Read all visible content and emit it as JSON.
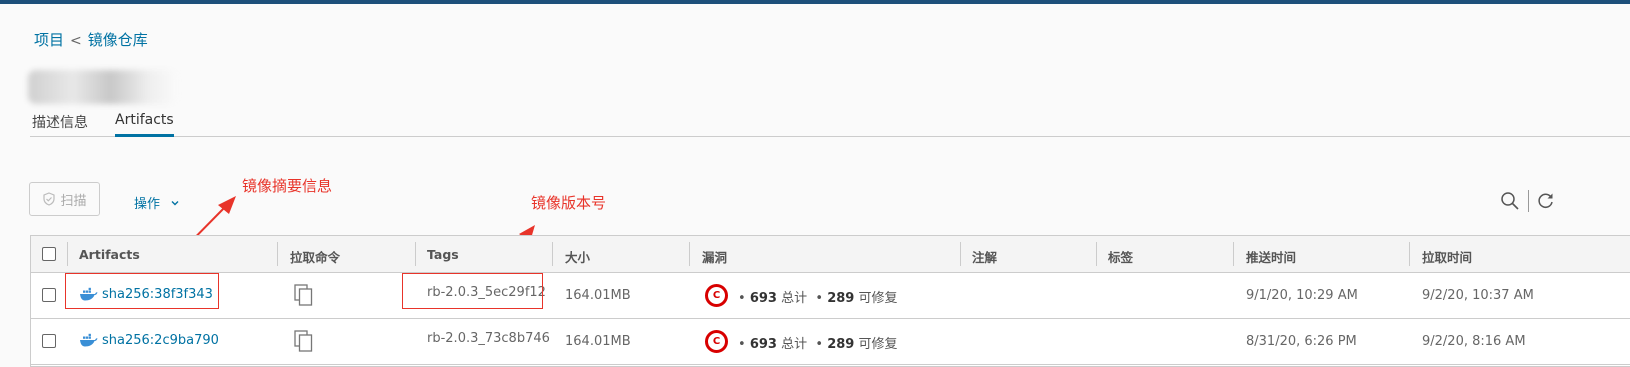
{
  "breadcrumb": {
    "projects": "项目",
    "separator": "<",
    "repository": "镜像仓库"
  },
  "tabs": [
    {
      "label": "描述信息"
    },
    {
      "label": "Artifacts"
    }
  ],
  "toolbar": {
    "scan_label": "扫描",
    "action_label": "操作"
  },
  "annotations": {
    "summary": "镜像摘要信息",
    "version": "镜像版本号"
  },
  "table": {
    "headers": {
      "artifacts": "Artifacts",
      "pull_command": "拉取命令",
      "tags": "Tags",
      "size": "大小",
      "vulnerabilities": "漏洞",
      "annotations": "注解",
      "labels": "标签",
      "push_time": "推送时间",
      "pull_time": "拉取时间"
    },
    "rows": [
      {
        "digest": "sha256:38f3f343",
        "tag": "rb-2.0.3_5ec29f12",
        "size": "164.01MB",
        "severity": "C",
        "total": "693",
        "total_label": "总计",
        "fixable": "289",
        "fixable_label": "可修复",
        "push_time": "9/1/20, 10:29 AM",
        "pull_time": "9/2/20, 10:37 AM"
      },
      {
        "digest": "sha256:2c9ba790",
        "tag": "rb-2.0.3_73c8b746",
        "size": "164.01MB",
        "severity": "C",
        "total": "693",
        "total_label": "总计",
        "fixable": "289",
        "fixable_label": "可修复",
        "push_time": "8/31/20, 6:26 PM",
        "pull_time": "9/2/20, 8:16 AM"
      }
    ]
  },
  "colors": {
    "brand": "#1d4f7a",
    "link": "#0072a3",
    "annotation": "#e8342a",
    "critical": "#d80000"
  }
}
